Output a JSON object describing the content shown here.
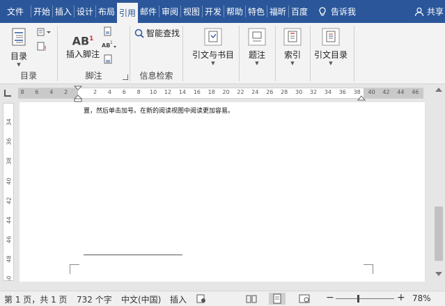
{
  "tabs": [
    {
      "label": "文件",
      "width": 44,
      "active": false
    },
    {
      "label": "开始",
      "width": 30,
      "active": false
    },
    {
      "label": "插入",
      "width": 30,
      "active": false
    },
    {
      "label": "设计",
      "width": 30,
      "active": false
    },
    {
      "label": "布局",
      "width": 30,
      "active": false
    },
    {
      "label": "引用",
      "width": 30,
      "active": true
    },
    {
      "label": "邮件",
      "width": 30,
      "active": false
    },
    {
      "label": "审阅",
      "width": 30,
      "active": false
    },
    {
      "label": "视图",
      "width": 30,
      "active": false
    },
    {
      "label": "开发",
      "width": 30,
      "active": false
    },
    {
      "label": "帮助",
      "width": 30,
      "active": false
    },
    {
      "label": "特色",
      "width": 30,
      "active": false
    },
    {
      "label": "福昕",
      "width": 30,
      "active": false
    },
    {
      "label": "百度",
      "width": 30,
      "active": false
    }
  ],
  "tell_me": "告诉我",
  "share": "共享",
  "ribbon": {
    "toc": {
      "label": "目录",
      "group": "目录"
    },
    "footnote": {
      "label": "插入脚注",
      "ab_text": "AB",
      "group": "脚注"
    },
    "search": {
      "label": "智能查找",
      "group": "信息检索"
    },
    "citations": {
      "label": "引文与书目"
    },
    "captions": {
      "label": "题注"
    },
    "index": {
      "label": "索引"
    },
    "toa": {
      "label": "引文目录"
    }
  },
  "ruler": {
    "ticks": [
      "8",
      "6",
      "4",
      "2",
      "",
      "2",
      "4",
      "6",
      "8",
      "10",
      "12",
      "14",
      "16",
      "18",
      "20",
      "22",
      "24",
      "26",
      "28",
      "30",
      "32",
      "34",
      "36",
      "38",
      "40",
      "42",
      "44",
      "46"
    ]
  },
  "vruler": {
    "ticks": [
      "34",
      "36",
      "38",
      "40",
      "42",
      "44",
      "46",
      "48",
      "50"
    ]
  },
  "document": {
    "text": "置，然后单击加号。在新的阅读视图中阅读更加容易。"
  },
  "status": {
    "page": "第 1 页，共 1 页",
    "words": "732 个字",
    "lang": "中文(中国)",
    "mode": "插入",
    "zoom": "78%",
    "zoom_value": 78
  },
  "colors": {
    "accent": "#2b579a"
  }
}
